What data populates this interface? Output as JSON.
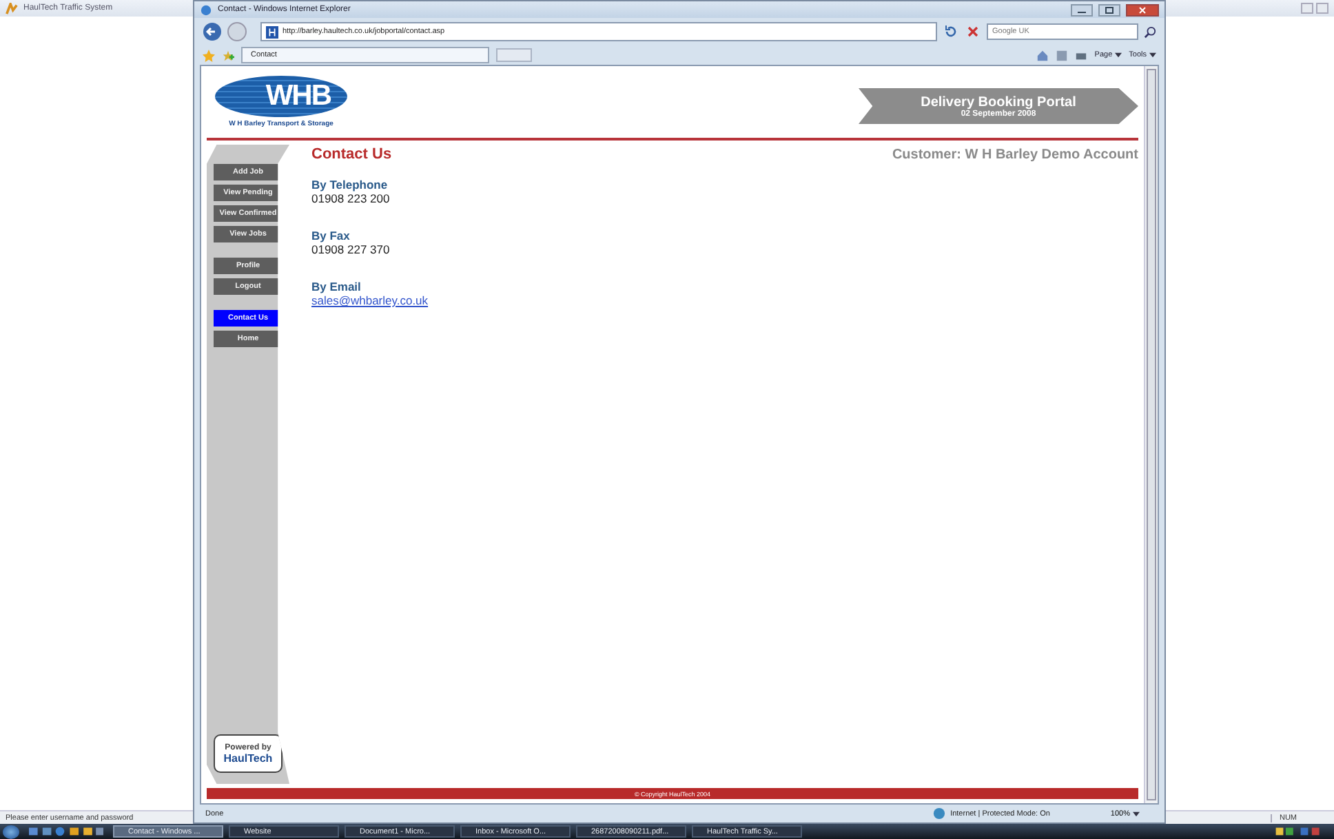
{
  "background_window": {
    "title": "HaulTech Traffic System",
    "status_text": "Please enter username and password",
    "status_indicator": "NUM"
  },
  "browser": {
    "title": "Contact - Windows Internet Explorer",
    "address": "http://barley.haultech.co.uk/jobportal/contact.asp",
    "search": {
      "placeholder": "Google UK"
    },
    "tabs": [
      {
        "label": "Contact",
        "selected": true
      }
    ],
    "toolbar": [
      "Page",
      "Tools"
    ],
    "status": "Done",
    "zone": "Internet | Protected Mode: On",
    "zoom": "100%"
  },
  "page": {
    "logo": "WHB",
    "company": "W H Barley Transport & Storage",
    "banner_title": "Delivery Booking Portal",
    "banner_date": "02 September 2008",
    "heading": "Contact Us",
    "customer": "Customer: W H Barley Demo Account",
    "nav_groups": [
      [
        {
          "label": "Add Job",
          "selected": false
        },
        {
          "label": "View Pending",
          "selected": false
        },
        {
          "label": "View Confirmed",
          "selected": false
        },
        {
          "label": "View Jobs",
          "selected": false
        }
      ],
      [
        {
          "label": "Profile",
          "selected": false
        },
        {
          "label": "Logout",
          "selected": false
        }
      ],
      [
        {
          "label": "Contact Us",
          "selected": true
        },
        {
          "label": "Home",
          "selected": false
        }
      ]
    ],
    "sections": [
      {
        "title": "By Telephone",
        "value": "01908 223 200",
        "kind": "text"
      },
      {
        "title": "By Fax",
        "value": "01908 227 370",
        "kind": "text"
      },
      {
        "title": "By Email",
        "value": "sales@whbarley.co.uk",
        "kind": "link"
      }
    ],
    "powered_by": "Powered by",
    "powered_brand": "HaulTech",
    "footer": "© Copyright  HaulTech 2004"
  },
  "taskbar": [
    {
      "label": "Contact - Windows ...",
      "selected": true
    },
    {
      "label": "Website",
      "selected": false
    },
    {
      "label": "Document1 - Micro...",
      "selected": false
    },
    {
      "label": "Inbox - Microsoft O...",
      "selected": false
    },
    {
      "label": "26872008090211.pdf...",
      "selected": false
    },
    {
      "label": "HaulTech Traffic Sy...",
      "selected": false
    }
  ]
}
